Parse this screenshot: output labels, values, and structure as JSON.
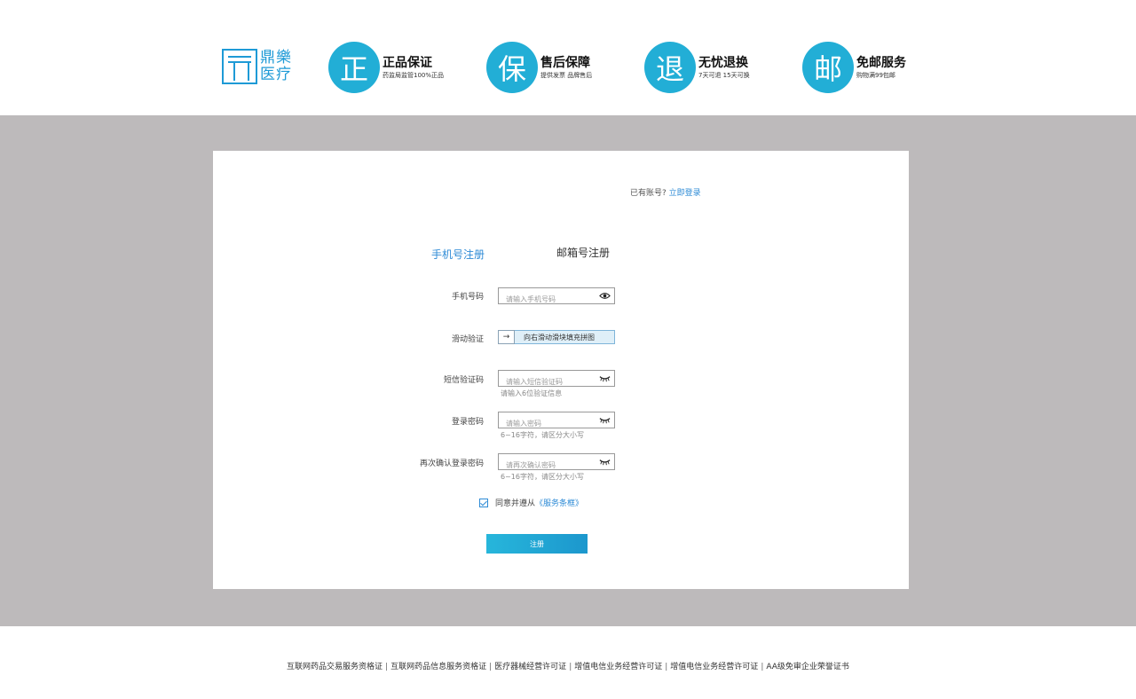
{
  "header": {
    "logo_text": "鼎樂医疗",
    "badges": [
      {
        "glyph": "正",
        "title": "正品保证",
        "sub": "药监局监管100%正品"
      },
      {
        "glyph": "保",
        "title": "售后保障",
        "sub": "提供发票 品牌售后"
      },
      {
        "glyph": "退",
        "title": "无忧退换",
        "sub": "7天可退 15天可换"
      },
      {
        "glyph": "邮",
        "title": "免邮服务",
        "sub": "购物满99包邮"
      }
    ]
  },
  "card": {
    "have_account": "已有账号?",
    "login_link": "立即登录",
    "tabs": {
      "phone": "手机号注册",
      "email": "邮箱号注册"
    },
    "phone": {
      "label": "手机号码",
      "placeholder": "请输入手机号码"
    },
    "slider": {
      "label": "滑动验证",
      "handle": "→",
      "text": "向右滑动滑块填充拼图"
    },
    "sms": {
      "label": "短信验证码",
      "placeholder": "请输入短信验证码",
      "hint": "请输入6位验证信息"
    },
    "password": {
      "label": "登录密码",
      "placeholder": "请输入密码",
      "hint": "6~16字符，请区分大小写"
    },
    "confirm": {
      "label": "再次确认登录密码",
      "placeholder": "请再次确认密码",
      "hint": "6~16字符，请区分大小写"
    },
    "agree": {
      "text": "同意并遵从",
      "link": "《服务条框》"
    },
    "submit": "注册"
  },
  "footer": {
    "links": [
      "互联网药品交易服务资格证",
      "互联网药品信息服务资格证",
      "医疗器械经营许可证",
      "增值电信业务经营许可证",
      "增值电信业务经营许可证",
      "AA级免审企业荣誉证书"
    ],
    "separator": "|"
  },
  "colors": {
    "accent": "#22aed6",
    "link": "#2e8bd6",
    "band": "#bdbabb"
  }
}
